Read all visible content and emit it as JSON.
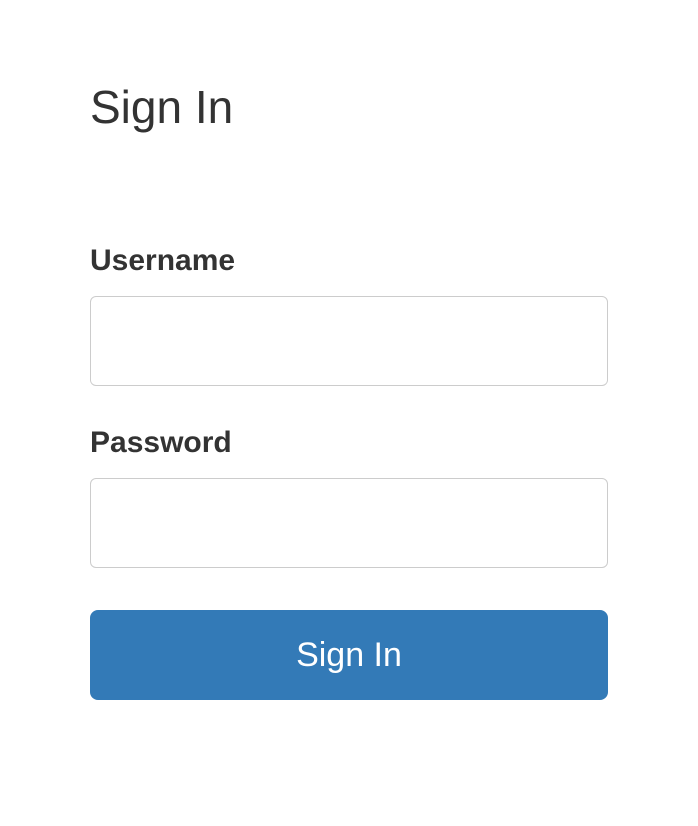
{
  "page": {
    "title": "Sign In"
  },
  "form": {
    "username": {
      "label": "Username",
      "value": ""
    },
    "password": {
      "label": "Password",
      "value": ""
    },
    "submit_label": "Sign In"
  }
}
